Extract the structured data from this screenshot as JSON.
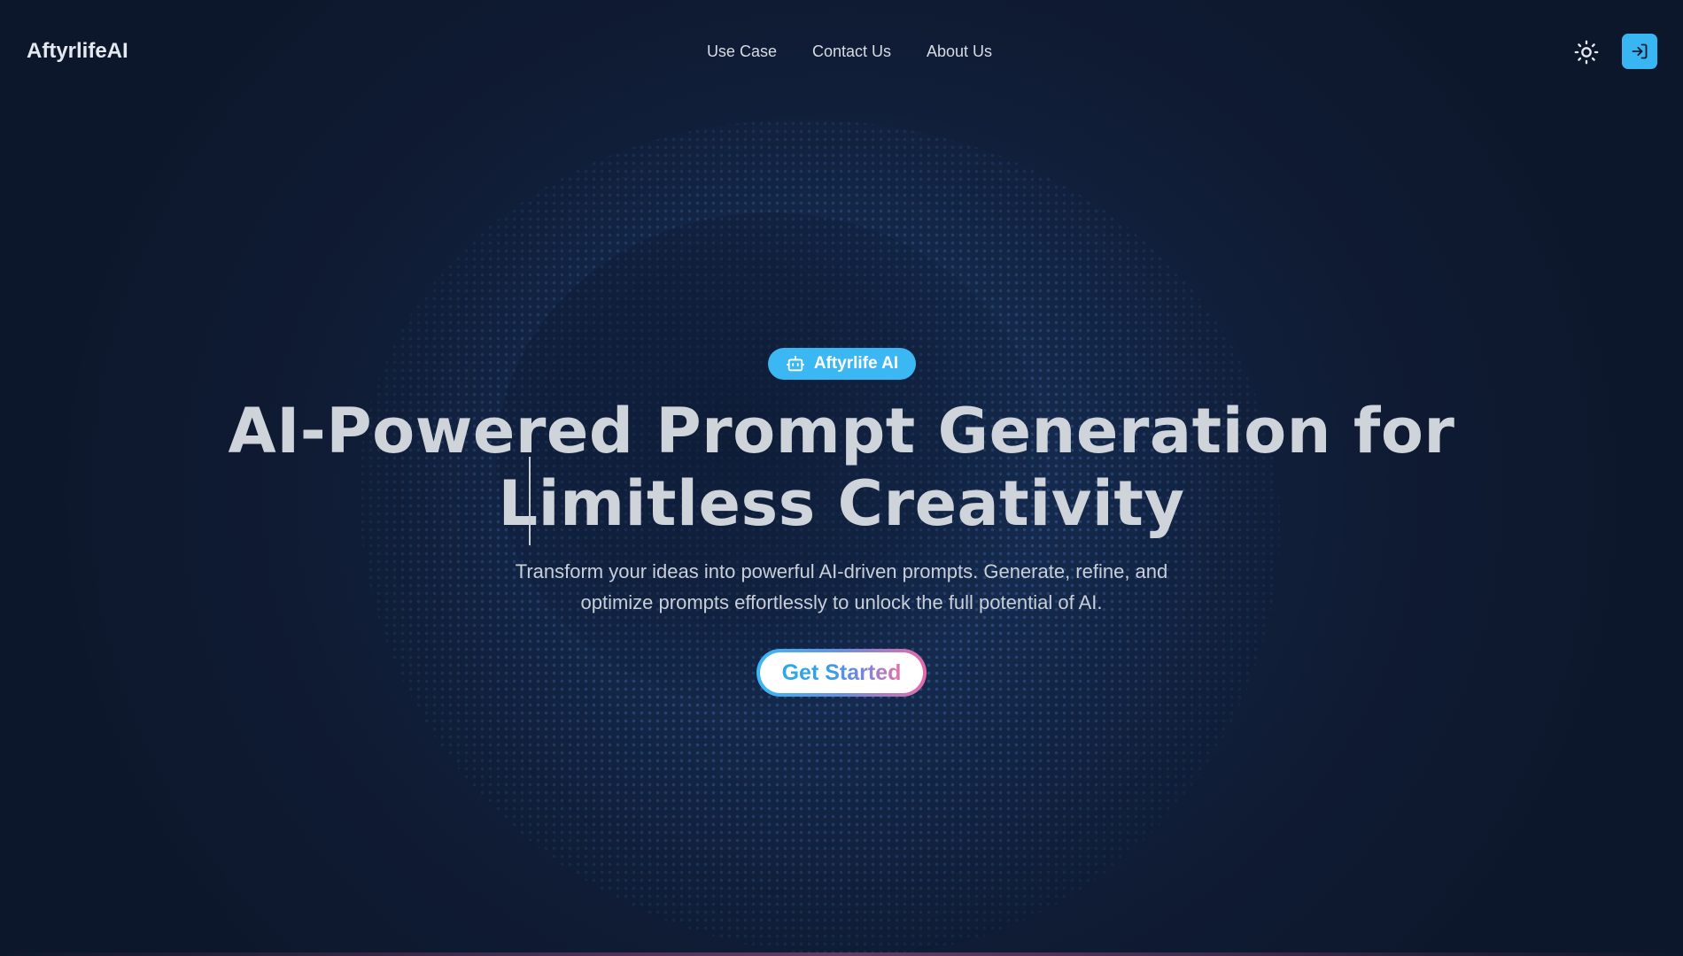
{
  "header": {
    "logo": "AftyrlifeAI",
    "nav": [
      {
        "label": "Use Case"
      },
      {
        "label": "Contact Us"
      },
      {
        "label": "About Us"
      }
    ],
    "theme_toggle_icon": "sun-icon",
    "login_icon": "login-icon"
  },
  "hero": {
    "badge": {
      "icon": "robot-icon",
      "label": "Aftyrlife AI"
    },
    "headline_line1": "AI-Powered Prompt Generation for",
    "headline_line2": "Limitless Creativity",
    "subtitle_line1": "Transform your ideas into powerful AI-driven prompts. Generate, refine, and",
    "subtitle_line2": "optimize prompts effortlessly to unlock the full potential of AI.",
    "cta_label": "Get Started"
  },
  "colors": {
    "accent": "#3bb8f4",
    "gradient_end": "#e56aa8",
    "background": "#0f1a30"
  }
}
